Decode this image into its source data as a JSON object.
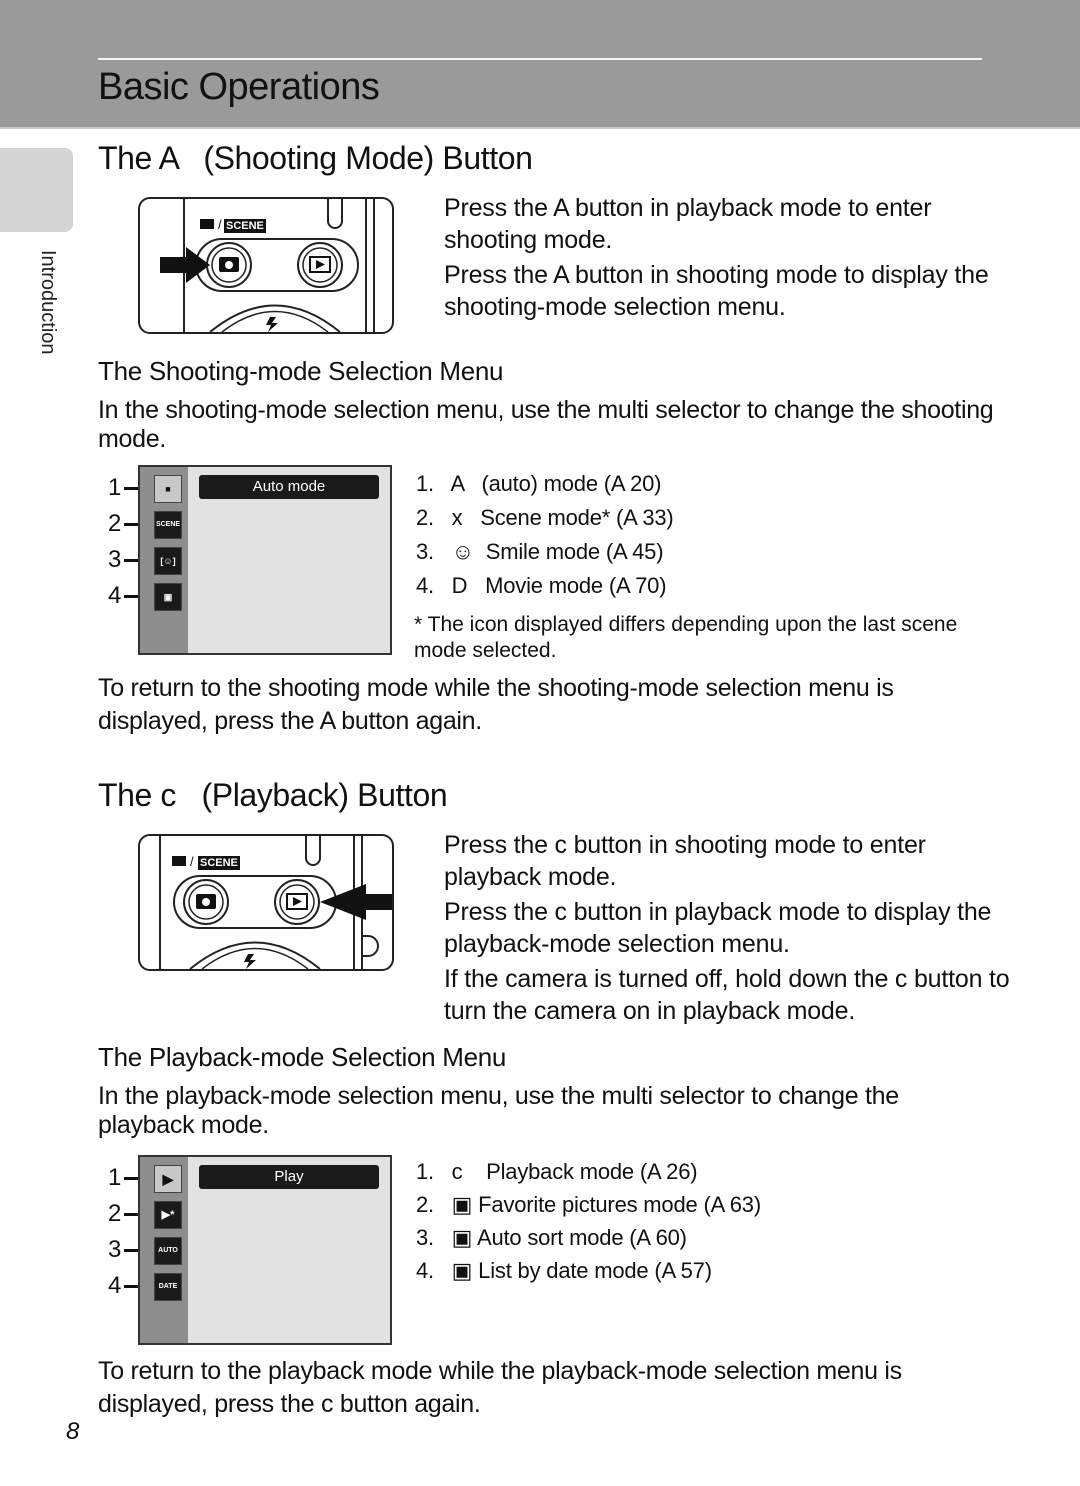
{
  "header": {
    "chapter_title": "Basic Operations"
  },
  "side_tab": {
    "label": "Introduction"
  },
  "shooting": {
    "section_title": "The A   (Shooting Mode) Button",
    "camera_label": "SCENE",
    "desc": [
      "Press the A  button in playback mode to enter shooting mode.",
      "Press the A  button in shooting mode to display the shooting-mode selection menu."
    ],
    "menu_title": "The Shooting-mode Selection Menu",
    "menu_intro": "In the shooting-mode selection menu, use the multi selector to change the shooting mode.",
    "screen_banner": "Auto mode",
    "screen_icons": [
      {
        "num": "1",
        "icon": "camera-icon",
        "glyph": "■",
        "selected": true
      },
      {
        "num": "2",
        "icon": "scene-icon",
        "glyph": "SCENE",
        "selected": false
      },
      {
        "num": "3",
        "icon": "smile-icon",
        "glyph": "[☺]",
        "selected": false
      },
      {
        "num": "4",
        "icon": "movie-icon",
        "glyph": "▣",
        "selected": false
      }
    ],
    "list": [
      "1.   A   (auto) mode (A 20)",
      "2.   x   Scene mode* (A 33)",
      "3.   ☺  Smile mode (A 45)",
      "4.   D   Movie mode (A 70)"
    ],
    "note": "*  The icon displayed differs depending upon the last scene mode selected.",
    "return_text": "To return to the shooting mode while the shooting-mode selection menu is displayed, press the A  button again."
  },
  "playback": {
    "section_title": "The c   (Playback) Button",
    "camera_label": "SCENE",
    "desc": [
      "Press the c  button in shooting mode to enter playback mode.",
      "Press the c  button in playback mode to display the playback-mode selection menu.",
      "If the camera is turned off, hold down the c button to turn the camera on in playback mode."
    ],
    "menu_title": "The Playback-mode Selection Menu",
    "menu_intro": "In the playback-mode selection menu, use the multi selector to change the playback mode.",
    "screen_banner": "Play",
    "screen_icons": [
      {
        "num": "1",
        "icon": "play-icon",
        "glyph": "▶",
        "selected": true
      },
      {
        "num": "2",
        "icon": "favorite-icon",
        "glyph": "▶*",
        "selected": false
      },
      {
        "num": "3",
        "icon": "auto-sort-icon",
        "glyph": "AUTO",
        "selected": false
      },
      {
        "num": "4",
        "icon": "date-icon",
        "glyph": "DATE",
        "selected": false
      }
    ],
    "list": [
      "1.   c    Playback mode (A 26)",
      "2.   ▣ Favorite pictures mode (A 63)",
      "3.   ▣ Auto sort mode (A 60)",
      "4.   ▣ List by date mode (A 57)"
    ],
    "return_text": "To return to the playback mode while the playback-mode selection menu is displayed, press the c  button again."
  },
  "footer": {
    "page_number": "8"
  }
}
